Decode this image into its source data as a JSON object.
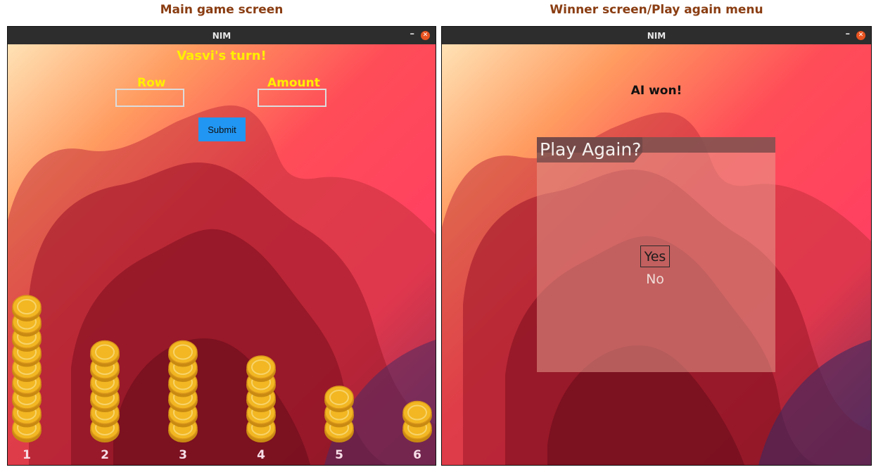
{
  "captions": {
    "left": "Main game screen",
    "right": "Winner screen/Play again menu"
  },
  "colors": {
    "accent_text": "#ffef00",
    "submit_button": "#2196f3",
    "coin": "#f2b722",
    "window_titlebar": "#2d2d2d",
    "close_button": "#e95420"
  },
  "game_window": {
    "title": "NIM",
    "minimize_label": "–",
    "close_icon": "close-icon",
    "turn_text": "Vasvi's turn!",
    "row_label": "Row",
    "amount_label": "Amount",
    "row_value": "",
    "amount_value": "",
    "submit_label": "Submit",
    "piles": [
      {
        "label": "1",
        "coins": 9
      },
      {
        "label": "2",
        "coins": 6
      },
      {
        "label": "3",
        "coins": 6
      },
      {
        "label": "4",
        "coins": 5
      },
      {
        "label": "5",
        "coins": 3
      },
      {
        "label": "6",
        "coins": 2
      }
    ]
  },
  "winner_window": {
    "title": "NIM",
    "minimize_label": "–",
    "close_icon": "close-icon",
    "winner_text": "AI won!",
    "menu_title": "Play Again?",
    "menu_options": [
      {
        "label": "Yes",
        "selected": true
      },
      {
        "label": "No",
        "selected": false
      }
    ]
  }
}
